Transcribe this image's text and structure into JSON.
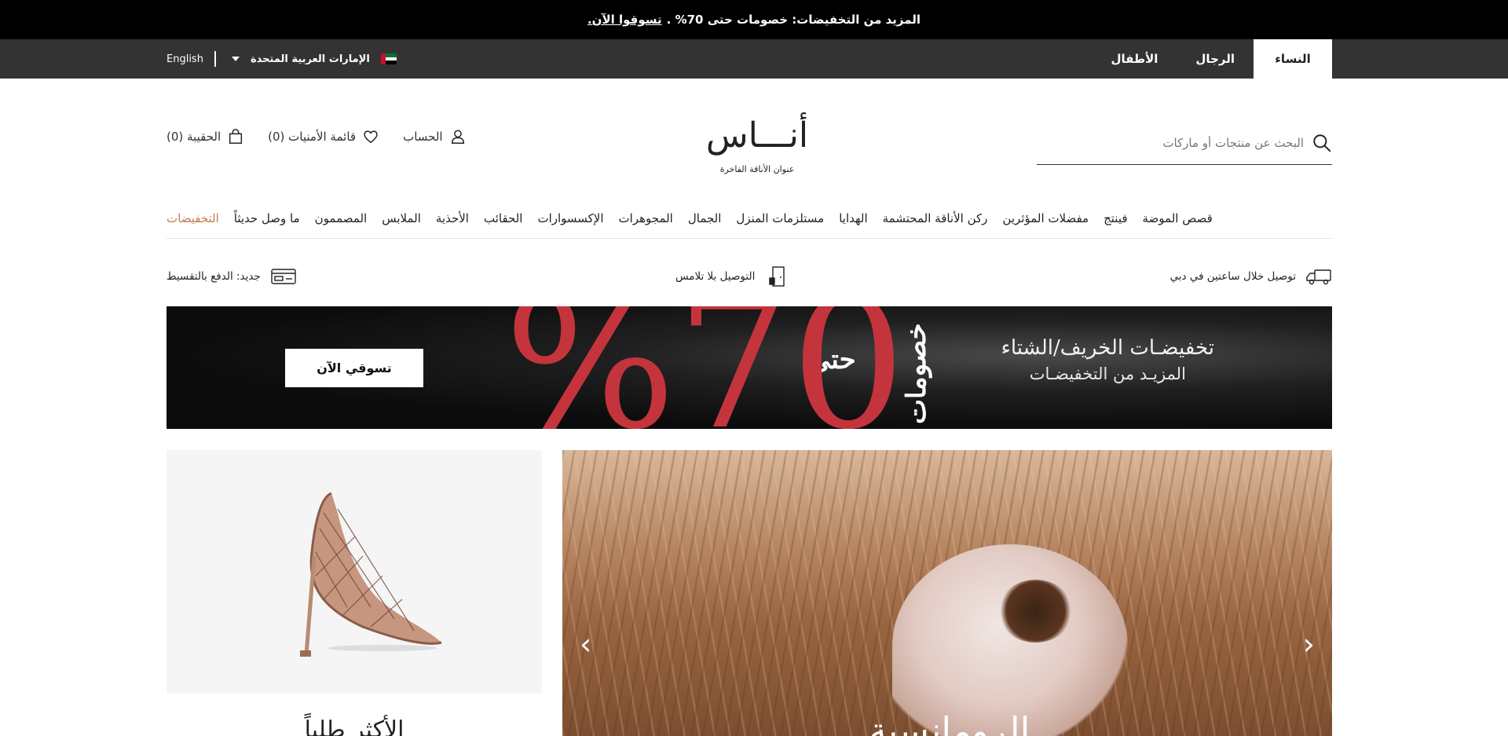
{
  "promo": {
    "text": "المزيد من التخفيضات: خصومات حتى 70% .",
    "link": "تسوقوا الآن."
  },
  "top_bar": {
    "gender_tabs": [
      {
        "label": "النساء"
      },
      {
        "label": "الرجال"
      },
      {
        "label": "الأطفال"
      }
    ],
    "country": "الإمارات العربية المتحدة",
    "language": "English"
  },
  "header": {
    "search_placeholder": "البحث عن منتجات أو ماركات",
    "logo": "أنـــاس",
    "tagline": "عنوان الأناقة الفاخرة",
    "account": "الحساب",
    "wishlist": "قائمة الأمنيات (0)",
    "bag": "الحقيبة (0)"
  },
  "nav": {
    "items": [
      "التخفيضات",
      "ما وصل حديثاً",
      "المصممون",
      "الملابس",
      "الأحذية",
      "الحقائب",
      "الإكسسوارات",
      "المجوهرات",
      "الجمال",
      "مستلزمات المنزل",
      "الهدايا",
      "ركن الأناقة المحتشمة",
      "مفضلات المؤثرين",
      "فينتج",
      "قصص الموضة"
    ]
  },
  "features": {
    "delivery": "توصيل خلال ساعتين في دبي",
    "contactless": "التوصيل بلا تلامس",
    "installments": "جديد: الدفع بالتقسيط"
  },
  "sale_banner": {
    "title": "تخفيضـات الخريف/الشتاء",
    "subtitle": "المزيـد من التخفيضـات",
    "vertical": "خصومات",
    "upto": "حتى",
    "percent": "%70",
    "cta": "تسوقي الآن"
  },
  "product": {
    "title": "الأكثر طلباً"
  },
  "hero": {
    "title": "الرومانسية",
    "prev": "‹",
    "next": "›"
  },
  "colors": {
    "accent_sale": "#c97b4f",
    "banner_red": "#c4343c"
  }
}
